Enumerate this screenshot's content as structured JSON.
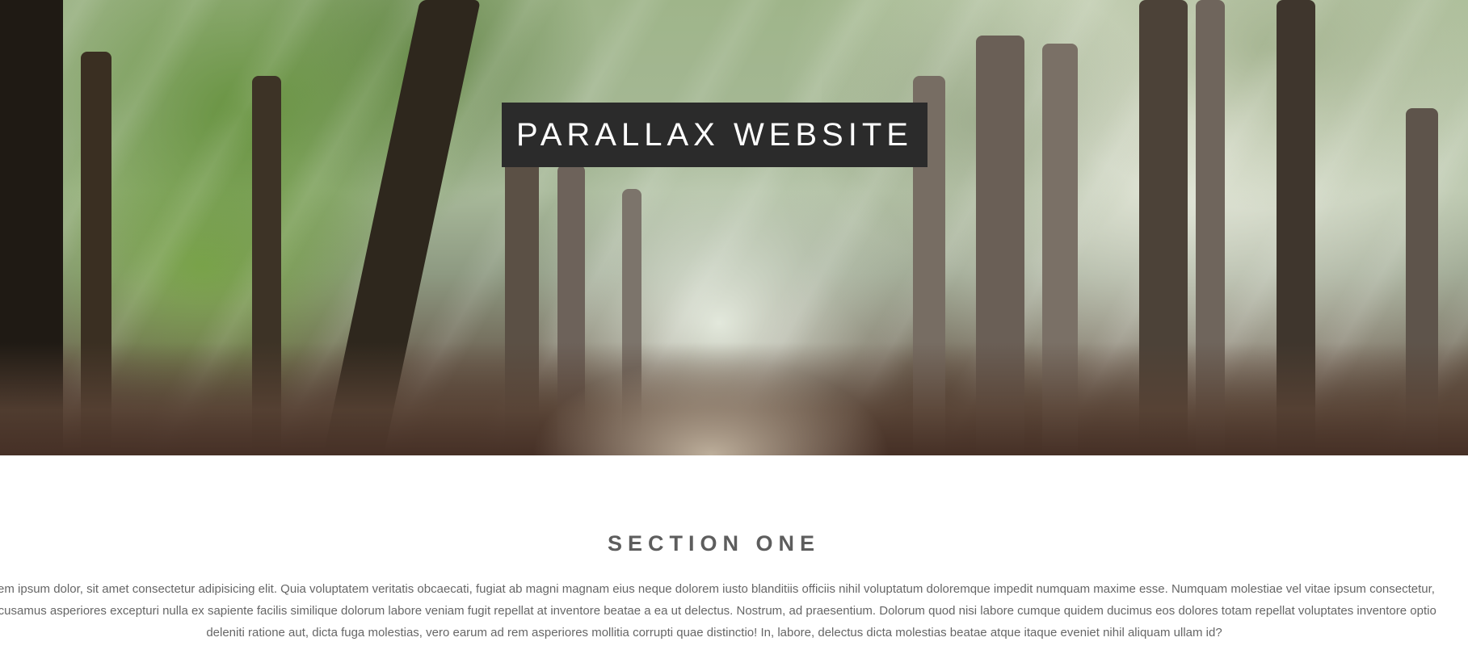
{
  "hero": {
    "title": "PARALLAX WEBSITE",
    "background_image": "forest-path-with-sun-rays",
    "title_box_color": "#2b2b2b",
    "title_text_color": "#ffffff"
  },
  "section_one": {
    "heading": "SECTION ONE",
    "heading_color": "#5d5d5d",
    "text_color": "#666666",
    "paragraph_lines": [
      "rem ipsum dolor, sit amet consectetur adipisicing elit. Quia voluptatem veritatis obcaecati, fugiat ab magni magnam eius neque dolorem iusto blanditiis officiis nihil voluptatum doloremque impedit numquam maxime esse. Numquam molestiae vel vitae ipsum consectetur,",
      "ccusamus asperiores excepturi nulla ex sapiente facilis similique dolorum labore veniam fugit repellat at inventore beatae a ea ut delectus. Nostrum, ad praesentium. Dolorum quod nisi labore cumque quidem ducimus eos dolores totam repellat voluptates inventore optio",
      "deleniti ratione aut, dicta fuga molestias, vero earum ad rem asperiores mollitia corrupti quae distinctio! In, labore, delectus dicta molestias beatae atque itaque eveniet nihil aliquam ullam id?"
    ]
  }
}
